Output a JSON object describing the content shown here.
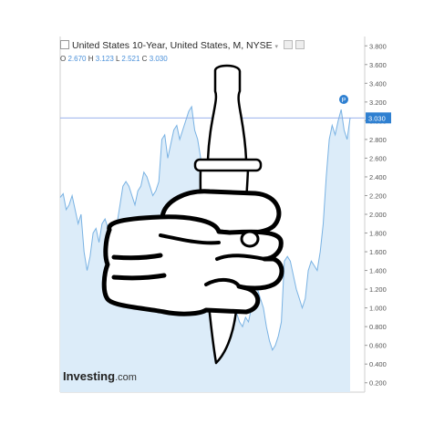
{
  "legend": {
    "title": "United States 10-Year, United States, M, NYSE",
    "open_key": "O",
    "open": "2.670",
    "high_key": "H",
    "high": "3.123",
    "low_key": "L",
    "low": "2.521",
    "close_key": "C",
    "close": "3.030"
  },
  "brand": {
    "name": "Investing",
    "suffix": ".com"
  },
  "colors": {
    "area_fill": "#dcecf9",
    "area_line": "#79b2e3",
    "last_line": "#8aa6e8",
    "badge": "#2f80d1"
  },
  "overlay_icon": "fist-holding-knife-icon",
  "price_badge_icon": "p-badge-icon",
  "chart_data": {
    "type": "area",
    "title": "United States 10-Year, United States, M, NYSE",
    "ylim": [
      0.1,
      3.9
    ],
    "yticks": [
      "3.800",
      "3.600",
      "3.400",
      "3.200",
      "3.000",
      "2.800",
      "2.600",
      "2.400",
      "2.200",
      "2.000",
      "1.800",
      "1.600",
      "1.400",
      "1.200",
      "1.000",
      "0.800",
      "0.600",
      "0.400",
      "0.200"
    ],
    "grid": false,
    "last_value": "3.030",
    "values": [
      2.18,
      2.22,
      2.05,
      2.1,
      2.2,
      2.05,
      1.9,
      2.0,
      1.6,
      1.4,
      1.55,
      1.8,
      1.85,
      1.7,
      1.9,
      1.95,
      1.85,
      1.7,
      1.8,
      1.9,
      2.1,
      2.3,
      2.35,
      2.3,
      2.2,
      2.1,
      2.25,
      2.3,
      2.45,
      2.4,
      2.3,
      2.2,
      2.25,
      2.35,
      2.8,
      2.85,
      2.6,
      2.75,
      2.9,
      2.95,
      2.8,
      2.9,
      3.0,
      3.1,
      3.15,
      2.9,
      2.8,
      2.6,
      2.3,
      2.0,
      1.8,
      1.55,
      1.5,
      1.35,
      1.2,
      1.0,
      0.9,
      0.8,
      1.0,
      0.95,
      0.85,
      0.8,
      0.9,
      0.85,
      1.0,
      1.3,
      1.2,
      1.1,
      1.0,
      0.8,
      0.65,
      0.55,
      0.6,
      0.7,
      0.85,
      1.5,
      1.55,
      1.5,
      1.35,
      1.2,
      1.1,
      1.0,
      1.1,
      1.4,
      1.5,
      1.45,
      1.4,
      1.6,
      1.9,
      2.4,
      2.8,
      2.95,
      2.85,
      3.0,
      3.12,
      2.9,
      2.8,
      3.03
    ]
  }
}
